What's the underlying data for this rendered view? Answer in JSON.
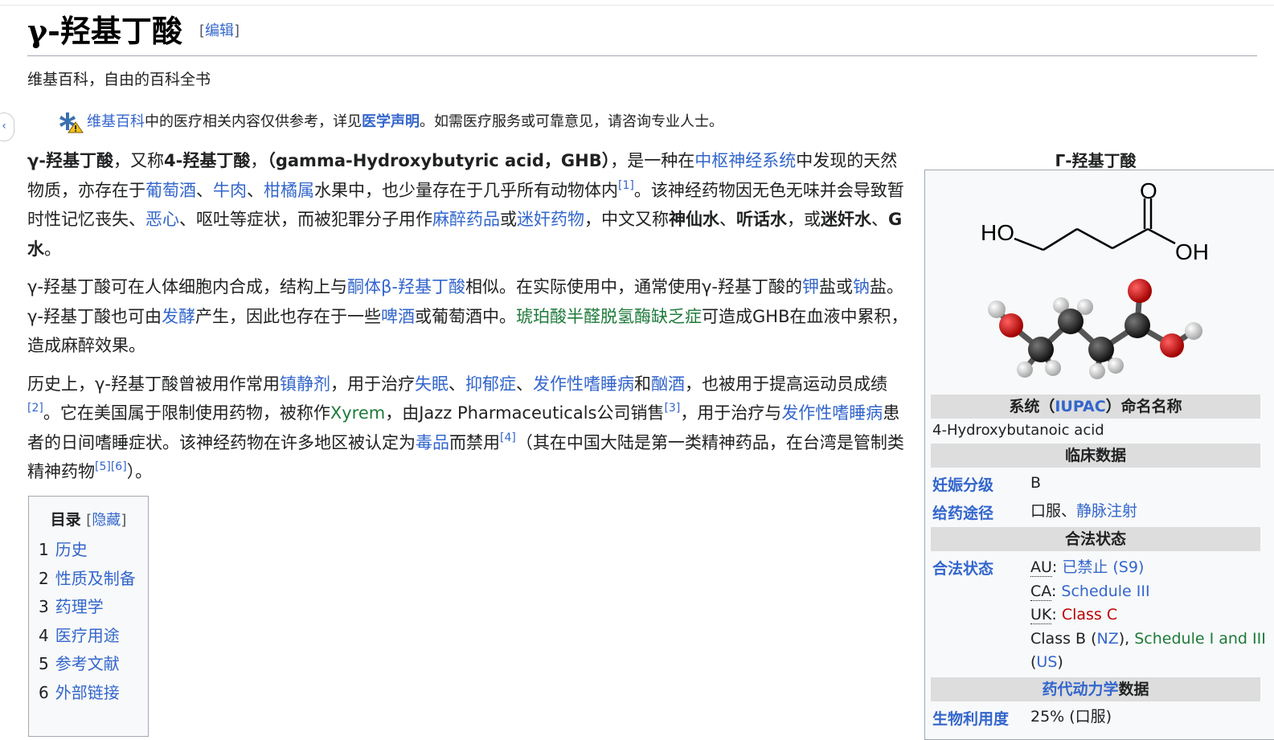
{
  "page": {
    "title": "γ-羟基丁酸",
    "edit_label": "编辑",
    "tagline": "维基百科，自由的百科全书"
  },
  "notice": {
    "wiki_link": "维基百科",
    "text1": "中的医疗相关内容仅供参考，详见",
    "disclaimer_link": "医学声明",
    "text2": "。如需医疗服务或可靠意见，请咨询专业人士。"
  },
  "article": {
    "p1": {
      "t0": "γ-羟基丁酸",
      "t1": "，又称",
      "t2": "4-羟基丁酸",
      "t3": "，",
      "t4": "（gamma-Hydroxybutyric acid，GHB）",
      "t5": "，是一种在",
      "l_cns": "中枢神经系统",
      "t6": "中发现的天然物质，亦存在于",
      "l_wine": "葡萄酒",
      "t7": "、",
      "l_beef": "牛肉",
      "t8": "、",
      "l_citrus": "柑橘属",
      "t9": "水果中，也少量存在于几乎所有动物体内",
      "ref1": "[1]",
      "t10": "。该神经药物因无色无味并会导致暂时性记忆丧失、",
      "l_nausea": "恶心",
      "t11": "、呕吐等症状，而被犯罪分子用作",
      "l_anes": "麻醉药品",
      "t12": "或",
      "l_rape": "迷奸药物",
      "t13": "，中文又称",
      "b1": "神仙水",
      "t14": "、",
      "b2": "听话水",
      "t15": "，或",
      "b3": "迷奸水",
      "t16": "、",
      "b4": "G水",
      "t17": "。"
    },
    "p2": {
      "t0": "γ-羟基丁酸可在人体细胞内合成，结构上与",
      "l_ketone": "酮体β-羟基丁酸",
      "t1": "相似。在实际使用中，通常使用γ-羟基丁酸的",
      "l_k": "钾",
      "t2": "盐或",
      "l_na": "钠",
      "t3": "盐。γ-羟基丁酸也可由",
      "l_ferm": "发酵",
      "t4": "产生，因此也存在于一些",
      "l_beer": "啤酒",
      "t5": "或葡萄酒中。",
      "l_ssadh": "琥珀酸半醛脱氢酶缺乏症",
      "t6": "可造成GHB在血液中累积，造成麻醉效果。"
    },
    "p3": {
      "t0": "历史上，γ-羟基丁酸曾被用作常用",
      "l_sed": "镇静剂",
      "t1": "，用于治疗",
      "l_insom": "失眠",
      "t2": "、",
      "l_dep": "抑郁症",
      "t3": "、",
      "l_narco": "发作性嗜睡病",
      "t4": "和",
      "l_alc": "酗酒",
      "t5": "，也被用于提高运动员成绩",
      "ref2": "[2]",
      "t6": "。它在美国属于限制使用药物，被称作",
      "l_xyrem": "Xyrem",
      "t7": "，由Jazz Pharmaceuticals公司销售",
      "ref3": "[3]",
      "t8": "，用于治疗与",
      "l_narco2": "发作性嗜睡病",
      "t9": "患者的日间嗜睡症状。该神经药物在许多地区被认定为",
      "l_drug": "毒品",
      "t10": "而禁用",
      "ref4": "[4]",
      "t11": "（其在中国大陆是第一类精神药品，在台湾是管制类精神药物",
      "ref5": "[5]",
      "ref6": "[6]",
      "t12": "）。"
    }
  },
  "toc": {
    "title": "目录",
    "toggle_open": "[",
    "toggle": "隐藏",
    "toggle_close": "]",
    "items": [
      {
        "num": "1",
        "label": "历史"
      },
      {
        "num": "2",
        "label": "性质及制备"
      },
      {
        "num": "3",
        "label": "药理学"
      },
      {
        "num": "4",
        "label": "医疗用途"
      },
      {
        "num": "5",
        "label": "参考文献"
      },
      {
        "num": "6",
        "label": "外部链接"
      }
    ]
  },
  "infobox": {
    "caption": "Γ-羟基丁酸",
    "structure_labels": {
      "ho": "HO",
      "o": "O",
      "oh": "OH"
    },
    "iupac_header_pre": "系统（",
    "iupac_header_link": "IUPAC",
    "iupac_header_post": "）命名名称",
    "iupac_name": "4-Hydroxybutanoic acid",
    "clinical_header": "临床数据",
    "pregnancy_label": "妊娠分级",
    "pregnancy_value": "B",
    "route_label": "给药途径",
    "route_value1": "口服、",
    "route_value2": "静脉注射",
    "legal_header": "合法状态",
    "legal_label": "合法状态",
    "legal": {
      "au_abbr": "AU",
      "au_link": "已禁止 (S9)",
      "ca_abbr": "CA",
      "ca_link": "Schedule III",
      "uk_abbr": "UK",
      "uk_link": "Class C",
      "nz_pre": "Class B (",
      "nz_link": "NZ",
      "nz_post": "), ",
      "us_link1": "Schedule I and III",
      "us_pre": "(",
      "us_link2": "US",
      "us_post": ")"
    },
    "pk_header_link": "药代动力学",
    "pk_header_post": "数据",
    "bio_label": "生物利用度",
    "bio_value": "25% (口服)"
  },
  "colors": {
    "link": "#3366cc",
    "link_green": "#1e7a3a",
    "link_red": "#ba0000",
    "header_bg": "#dddddd",
    "infobox_bg": "#f8f9fa"
  }
}
